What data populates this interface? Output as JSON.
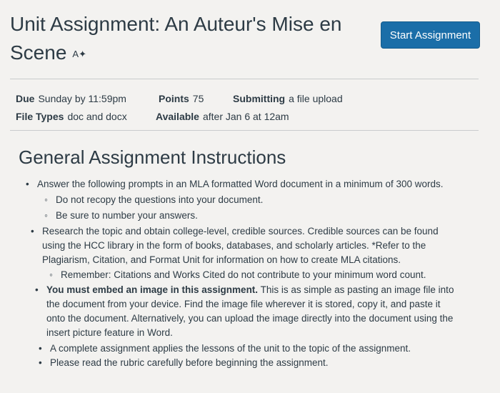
{
  "header": {
    "title": "Unit Assignment: An Auteur's Mise en Scene",
    "start_button": "Start Assignment"
  },
  "details": {
    "due_label": "Due",
    "due_value": "Sunday by 11:59pm",
    "points_label": "Points",
    "points_value": "75",
    "submitting_label": "Submitting",
    "submitting_value": "a file upload",
    "filetypes_label": "File Types",
    "filetypes_value": "doc and docx",
    "available_label": "Available",
    "available_value": "after Jan 6 at 12am"
  },
  "instructions": {
    "heading": "General Assignment Instructions",
    "item1": "Answer the following prompts in an MLA formatted Word document in a minimum of 300 words.",
    "item1_sub1": "Do not recopy the questions into your document.",
    "item1_sub2": "Be sure to number your answers.",
    "item2": "Research the topic and obtain college-level, credible sources. Credible sources can be found using the HCC library in the form of books, databases, and scholarly articles. *Refer to the Plagiarism, Citation, and Format Unit for information on how to create MLA citations.",
    "item2_sub1": "Remember: Citations and Works Cited do not contribute to your minimum word count.",
    "item3_bold": "You must embed an image in this assignment.",
    "item3_rest": " This is as simple as pasting an image file into the document from your device. Find the image file wherever it is stored, copy it, and paste it onto the document. Alternatively, you can upload the image directly into the document using the insert picture feature in Word.",
    "item4": "A complete assignment applies the lessons of the unit to the topic of the assignment.",
    "item5": "Please read the rubric carefully before beginning the assignment."
  },
  "colors": {
    "button": "#1b6ea8",
    "text": "#2d3b45",
    "background": "#f3f2f0"
  },
  "icons": {
    "title_icon": "immersive-reader-icon"
  }
}
